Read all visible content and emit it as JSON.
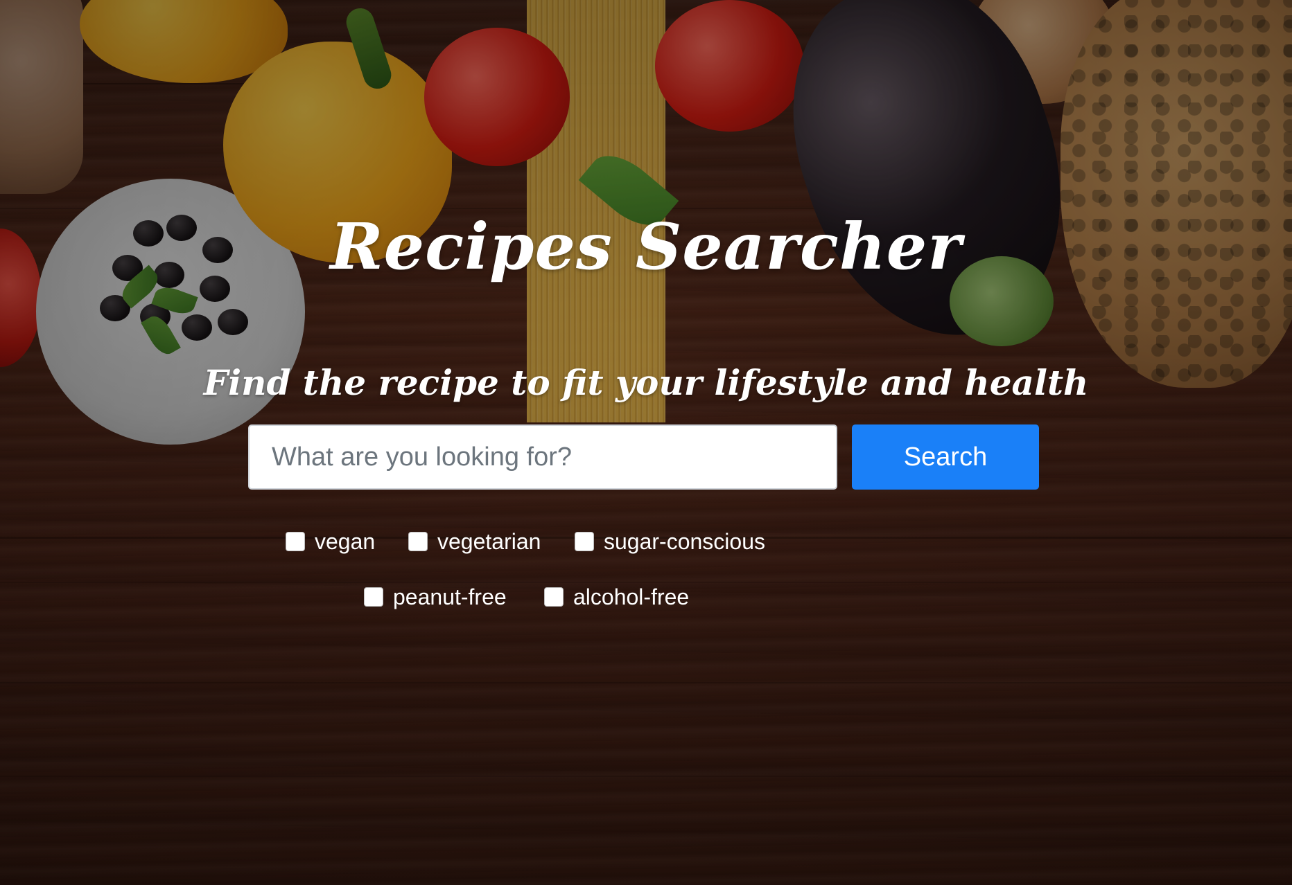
{
  "header": {
    "title": "Recipes Searcher",
    "subtitle": "Find the recipe to fit your lifestyle and health"
  },
  "search": {
    "placeholder": "What are you looking for?",
    "value": "",
    "button_label": "Search"
  },
  "filters": [
    {
      "label": "vegan",
      "checked": false
    },
    {
      "label": "vegetarian",
      "checked": false
    },
    {
      "label": "sugar-conscious",
      "checked": false
    },
    {
      "label": "peanut-free",
      "checked": false
    },
    {
      "label": "alcohol-free",
      "checked": false
    }
  ],
  "colors": {
    "accent": "#1a80f8",
    "text": "#ffffff"
  }
}
